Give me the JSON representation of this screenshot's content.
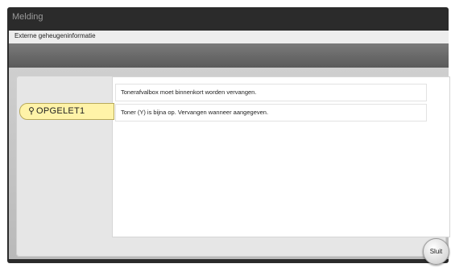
{
  "window": {
    "title": "Melding"
  },
  "header": {
    "subtitle": "Externe geheugeninformatie"
  },
  "alert": {
    "level_label": "OPGELET1",
    "icon": "warning-icon"
  },
  "messages": [
    {
      "text": "Tonerafvalbox moet binnenkort worden vervangen."
    },
    {
      "text": "Toner (Y) is bijna op. Vervangen wanneer aangegeven."
    }
  ],
  "actions": {
    "close_label": "Sluit"
  },
  "colors": {
    "alert_fill": "#fff3a8",
    "frame": "#2b2b2b",
    "panel": "#e6e6e6"
  }
}
